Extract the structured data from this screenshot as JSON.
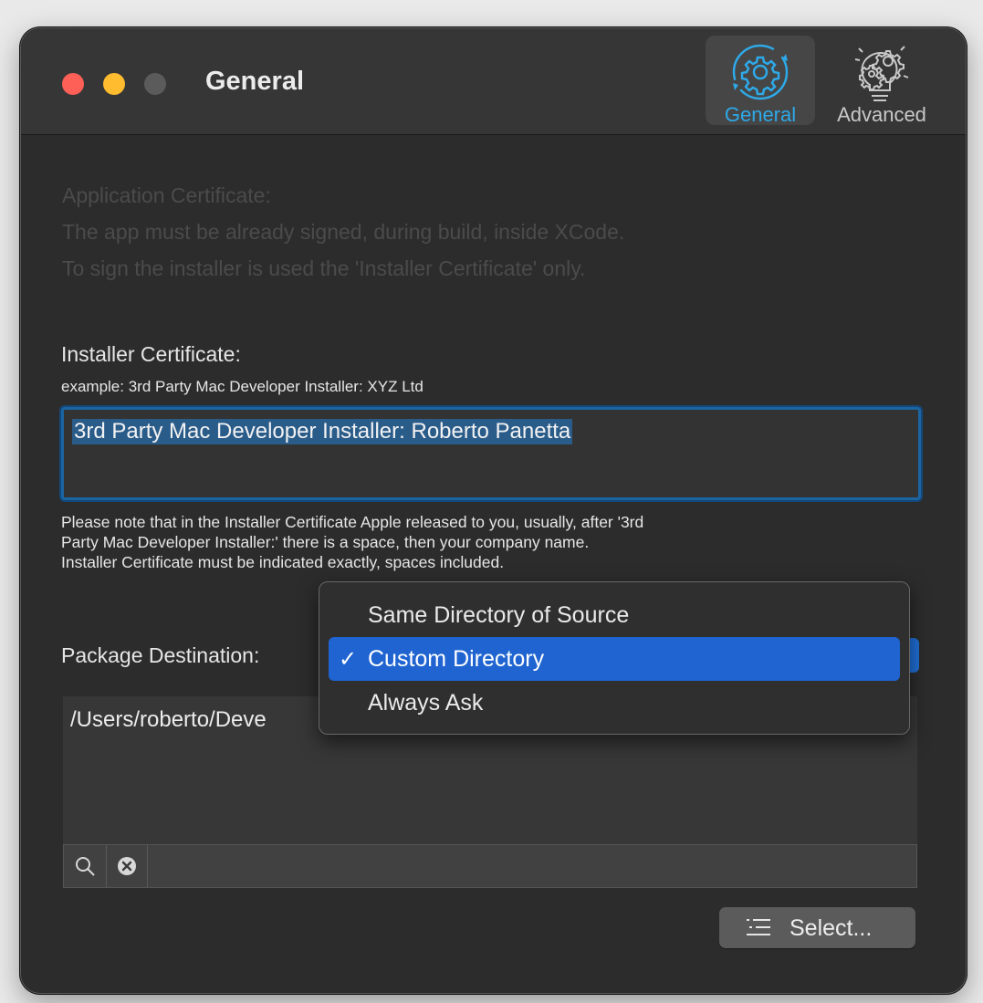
{
  "window": {
    "title": "General"
  },
  "toolbar": {
    "items": [
      {
        "label": "General",
        "icon": "gear-sync-icon",
        "selected": true
      },
      {
        "label": "Advanced",
        "icon": "lightbulb-gears-icon",
        "selected": false
      }
    ]
  },
  "app_cert": {
    "heading": "Application Certificate:",
    "line1": "The app must be already signed, during build, inside XCode.",
    "line2": "To sign the installer is used the 'Installer Certificate' only."
  },
  "installer_cert": {
    "label": "Installer Certificate:",
    "example": "example: 3rd Party Mac Developer Installer: XYZ Ltd",
    "value": "3rd Party Mac Developer Installer: Roberto Panetta",
    "note_line1": "Please note that in the Installer Certificate Apple released to you, usually, after '3rd",
    "note_line2": "Party Mac Developer Installer:' there is a space, then your company name.",
    "note_line3": "Installer Certificate must be indicated exactly, spaces included."
  },
  "destination": {
    "label": "Package Destination:",
    "path": "/Users/roberto/Deve",
    "menu_options": [
      {
        "label": "Same Directory of Source",
        "checked": false
      },
      {
        "label": "Custom Directory",
        "checked": true
      },
      {
        "label": "Always Ask",
        "checked": false
      }
    ],
    "check_mark": "✓"
  },
  "buttons": {
    "select": "Select..."
  },
  "colors": {
    "accent": "#2ea9e8",
    "selection": "#1f64d1"
  }
}
